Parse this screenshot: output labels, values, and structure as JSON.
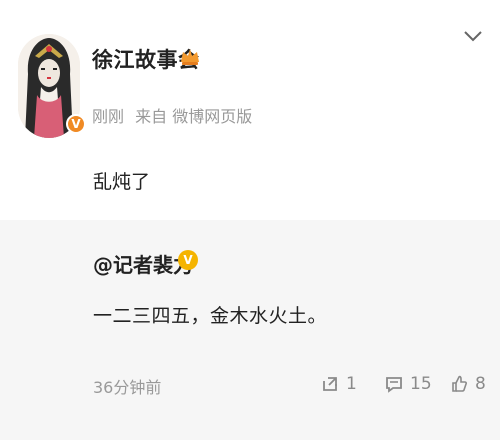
{
  "post": {
    "username": "徐江故事会",
    "time": "刚刚",
    "source": "来自 微博网页版",
    "text": "乱炖了"
  },
  "icons": {
    "avatar": "avatar",
    "vip_badge": "verified-badge",
    "crown": "crown-icon",
    "chevron": "chevron-down-icon",
    "repost": "repost-icon",
    "comment": "comment-icon",
    "like": "like-icon"
  },
  "repost": {
    "user": "@记者裴力",
    "text": "一二三四五，金木水火土。",
    "time": "36分钟前",
    "counts": {
      "repost": "1",
      "comment": "15",
      "like": "8"
    }
  },
  "colors": {
    "accent_orange": "#f08a24",
    "badge_yellow": "#f5b400",
    "meta_gray": "#999999",
    "repost_bg": "#f6f6f6"
  }
}
